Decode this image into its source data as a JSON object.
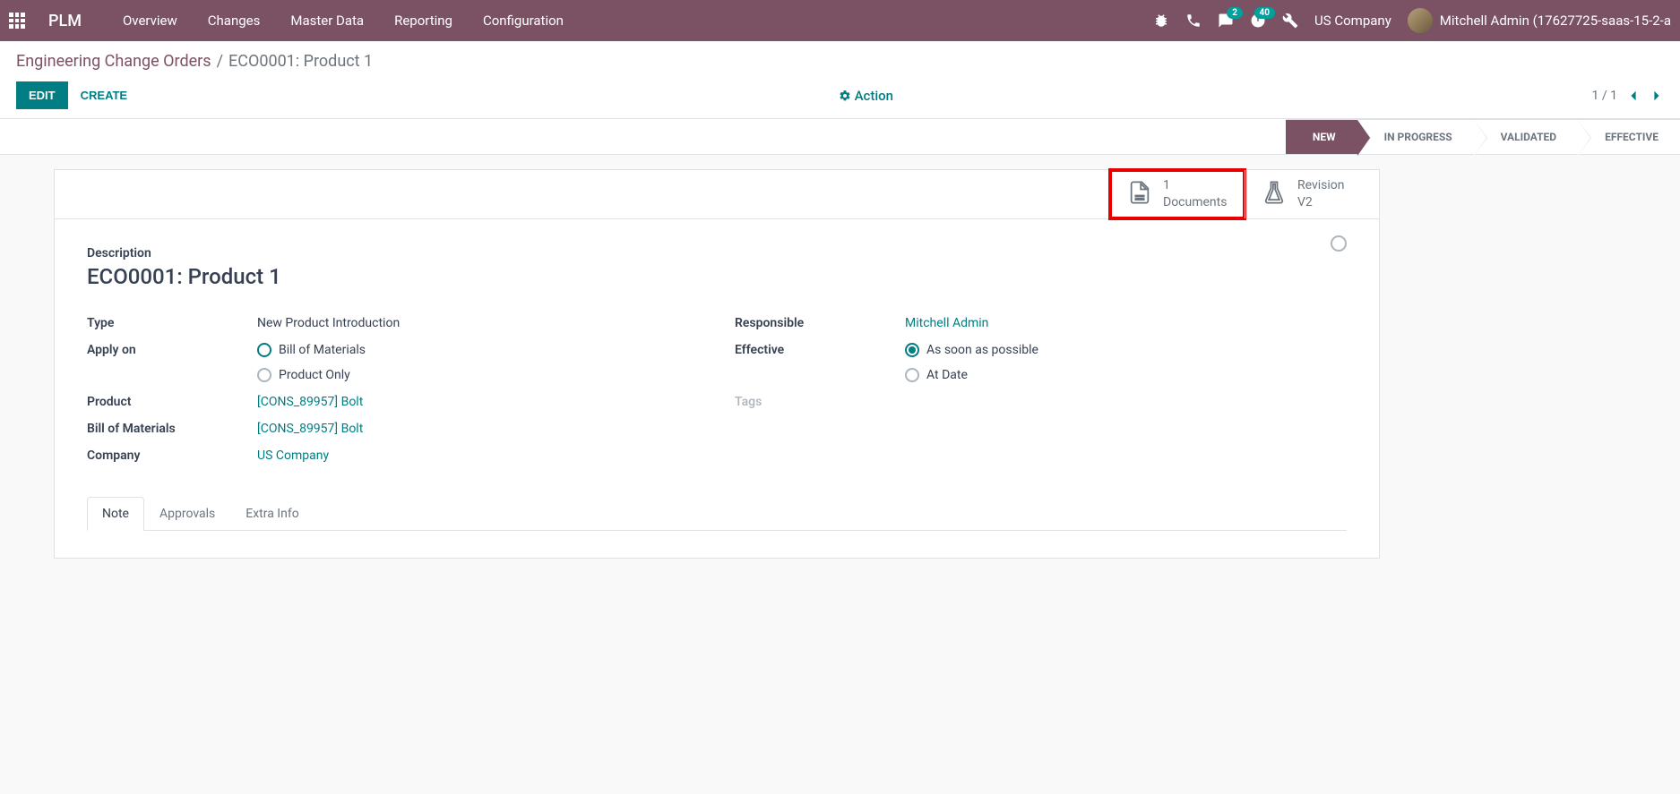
{
  "brand": "PLM",
  "nav": [
    "Overview",
    "Changes",
    "Master Data",
    "Reporting",
    "Configuration"
  ],
  "badges": {
    "messages": "2",
    "activities": "40"
  },
  "company": "US Company",
  "user": "Mitchell Admin (17627725-saas-15-2-a",
  "breadcrumb": {
    "parent": "Engineering Change Orders",
    "current": "ECO0001: Product 1"
  },
  "buttons": {
    "edit": "EDIT",
    "create": "CREATE",
    "action": "Action"
  },
  "pager": {
    "text": "1 / 1"
  },
  "stages": [
    "NEW",
    "IN PROGRESS",
    "VALIDATED",
    "EFFECTIVE"
  ],
  "stat_buttons": {
    "documents": {
      "count": "1",
      "label": "Documents"
    },
    "revision": {
      "line1": "Revision",
      "line2": "V2"
    }
  },
  "form": {
    "description_label": "Description",
    "title": "ECO0001: Product 1",
    "left": {
      "type_label": "Type",
      "type_value": "New Product Introduction",
      "apply_label": "Apply on",
      "apply_opt1": "Bill of Materials",
      "apply_opt2": "Product Only",
      "product_label": "Product",
      "product_value": "[CONS_89957] Bolt",
      "bom_label": "Bill of Materials",
      "bom_value": "[CONS_89957] Bolt",
      "company_label": "Company",
      "company_value": "US Company"
    },
    "right": {
      "responsible_label": "Responsible",
      "responsible_value": "Mitchell Admin",
      "effective_label": "Effective",
      "effective_opt1": "As soon as possible",
      "effective_opt2": "At Date",
      "tags_label": "Tags"
    }
  },
  "tabs": [
    "Note",
    "Approvals",
    "Extra Info"
  ]
}
